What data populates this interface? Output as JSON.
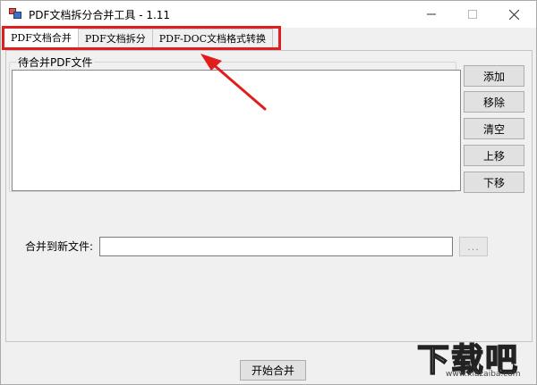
{
  "window": {
    "title": "PDF文档拆分合并工具 - 1.11",
    "controls": {
      "minimize": "minimize-icon",
      "maximize": "maximize-icon",
      "close": "close-icon"
    }
  },
  "tabs": [
    {
      "label": "PDF文档合并",
      "active": true
    },
    {
      "label": "PDF文档拆分",
      "active": false
    },
    {
      "label": "PDF-DOC文档格式转换",
      "active": false
    }
  ],
  "merge_page": {
    "group_label": "待合并PDF文件",
    "file_list": [],
    "buttons": {
      "add": "添加",
      "remove": "移除",
      "clear": "清空",
      "move_up": "上移",
      "move_down": "下移"
    },
    "output_label": "合并到新文件:",
    "output_value": "",
    "browse_label": "...",
    "start_label": "开始合并"
  },
  "watermark": {
    "logo": "下载吧",
    "url": "www.xiazaiba.com"
  },
  "colors": {
    "highlight": "#e01e1e",
    "window_bg": "#f0f0f0",
    "button_bg": "#e1e1e1"
  }
}
